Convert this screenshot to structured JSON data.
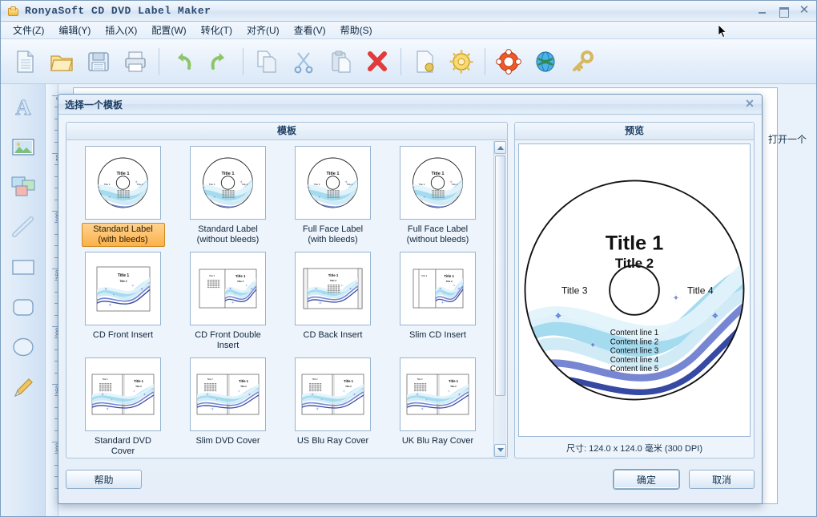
{
  "window": {
    "title": "RonyaSoft CD DVD Label Maker",
    "icon": "app-disc-icon",
    "controls": {
      "minimize": "–",
      "maximize": "❐",
      "close": "✕"
    }
  },
  "menu": [
    {
      "label": "文件(Z)",
      "name": "menu-file"
    },
    {
      "label": "编辑(Y)",
      "name": "menu-edit"
    },
    {
      "label": "插入(X)",
      "name": "menu-insert"
    },
    {
      "label": "配置(W)",
      "name": "menu-configure"
    },
    {
      "label": "转化(T)",
      "name": "menu-convert"
    },
    {
      "label": "对齐(U)",
      "name": "menu-align"
    },
    {
      "label": "查看(V)",
      "name": "menu-view"
    },
    {
      "label": "帮助(S)",
      "name": "menu-help"
    }
  ],
  "toolbar": [
    {
      "icon": "new-document-icon"
    },
    {
      "icon": "open-folder-icon"
    },
    {
      "icon": "save-disk-icon"
    },
    {
      "icon": "print-icon"
    },
    {
      "sep": true
    },
    {
      "icon": "undo-icon"
    },
    {
      "icon": "redo-icon"
    },
    {
      "sep": true
    },
    {
      "icon": "copy-icon"
    },
    {
      "icon": "cut-scissors-icon"
    },
    {
      "icon": "paste-icon"
    },
    {
      "icon": "delete-x-icon"
    },
    {
      "sep": true
    },
    {
      "icon": "page-setup-icon"
    },
    {
      "icon": "settings-gear-icon"
    },
    {
      "sep": true
    },
    {
      "icon": "lifebuoy-support-icon"
    },
    {
      "icon": "globe-web-icon"
    },
    {
      "icon": "key-register-icon"
    }
  ],
  "tools": [
    {
      "icon": "text-tool-icon"
    },
    {
      "icon": "image-tool-icon"
    },
    {
      "icon": "collage-tool-icon"
    },
    {
      "icon": "line-tool-icon"
    },
    {
      "icon": "rectangle-tool-icon"
    },
    {
      "icon": "rounded-rectangle-tool-icon"
    },
    {
      "icon": "ellipse-tool-icon"
    },
    {
      "icon": "pencil-tool-icon"
    }
  ],
  "ruler": {
    "unit": "mm",
    "ticks": [
      "0",
      "50",
      "100",
      "150",
      "200",
      "250",
      "300"
    ]
  },
  "canvas": {
    "obscured_text": "打开一个"
  },
  "dialog": {
    "title": "选择一个模板",
    "close_label": "✕",
    "templates_panel": {
      "header": "模板"
    },
    "preview_panel": {
      "header": "预览",
      "size_text": "尺寸: 124.0 x 124.0 毫米 (300 DPI)",
      "disc": {
        "title1": "Title 1",
        "title2": "Title 2",
        "title3": "Title 3",
        "title4": "Title 4",
        "content_lines": [
          "Content line 1",
          "Content line 2",
          "Content line 3",
          "Content line 4",
          "Content line 5"
        ]
      }
    },
    "templates": [
      {
        "label": "Standard Label (with bleeds)",
        "kind": "disc",
        "selected": true
      },
      {
        "label": "Standard Label (without bleeds)",
        "kind": "disc",
        "selected": false
      },
      {
        "label": "Full Face Label (with bleeds)",
        "kind": "disc",
        "selected": false
      },
      {
        "label": "Full Face Label (without bleeds)",
        "kind": "disc",
        "selected": false
      },
      {
        "label": "CD Front Insert",
        "kind": "single",
        "selected": false
      },
      {
        "label": "CD Front Double Insert",
        "kind": "double",
        "selected": false
      },
      {
        "label": "CD Back Insert",
        "kind": "back",
        "selected": false
      },
      {
        "label": "Slim CD Insert",
        "kind": "slim",
        "selected": false
      },
      {
        "label": "Standard DVD Cover",
        "kind": "cover",
        "selected": false
      },
      {
        "label": "Slim DVD Cover",
        "kind": "cover",
        "selected": false
      },
      {
        "label": "US Blu Ray Cover",
        "kind": "cover",
        "selected": false
      },
      {
        "label": "UK Blu Ray Cover",
        "kind": "cover",
        "selected": false
      }
    ],
    "buttons": {
      "help": "帮助",
      "ok": "确定",
      "cancel": "取消"
    }
  },
  "colors": {
    "accent": "#1c3d63",
    "selection": "#fbb149",
    "swirl_dark": "#2b3f9e",
    "swirl_light": "#a9dcee",
    "chrome": "#d4e3f4"
  }
}
